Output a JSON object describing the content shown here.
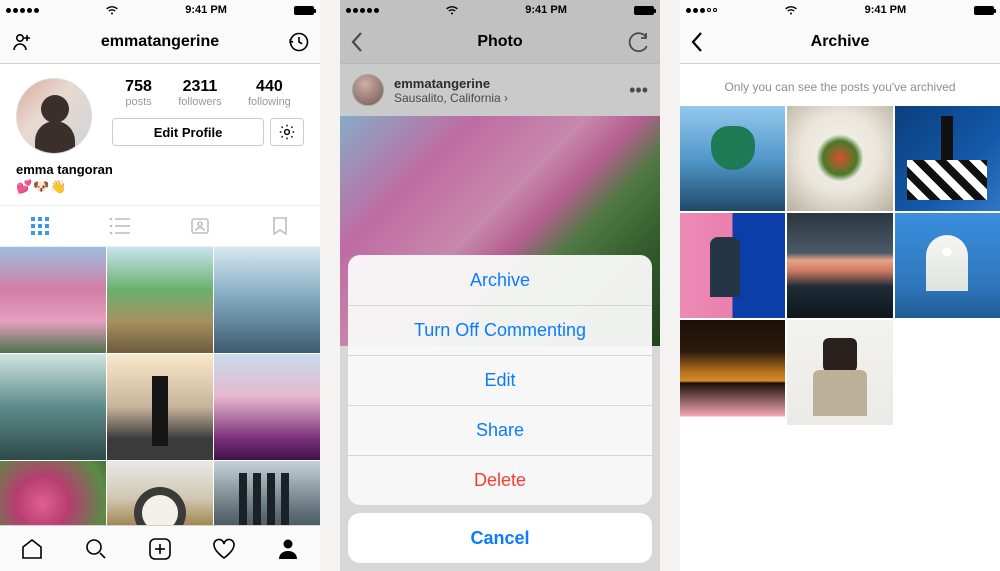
{
  "status": {
    "time": "9:41 PM",
    "signal_dots": 5,
    "wifi_icon": "wifi-icon",
    "battery_full": true
  },
  "screen1": {
    "add_friend_icon": "add-person-icon",
    "title": "emmatangerine",
    "history_icon": "clock-history-icon",
    "stats": {
      "posts": {
        "count": "758",
        "label": "posts"
      },
      "followers": {
        "count": "2311",
        "label": "followers"
      },
      "following": {
        "count": "440",
        "label": "following"
      }
    },
    "edit_profile": "Edit Profile",
    "settings_icon": "gear-icon",
    "display_name": "emma tangoran",
    "bio_emoji": "💕🐶👋",
    "view_tabs": [
      "grid-icon",
      "list-icon",
      "tagged-icon",
      "bookmark-icon"
    ],
    "active_view_tab": 0,
    "thumbs": [
      "t1",
      "t2",
      "t3",
      "t4",
      "t5",
      "t6",
      "t7",
      "t8",
      "t9"
    ],
    "tabbar": [
      "home-icon",
      "search-icon",
      "new-post-icon",
      "activity-icon",
      "profile-icon"
    ],
    "active_tabbar": 4
  },
  "screen2": {
    "back_icon": "chevron-left-icon",
    "title": "Photo",
    "refresh_icon": "refresh-icon",
    "post_user": "emmatangerine",
    "post_location": "Sausalito, California ›",
    "more_icon": "more-icon",
    "sheet": {
      "actions": [
        "Archive",
        "Turn Off Commenting",
        "Edit",
        "Share",
        "Delete"
      ],
      "destructive_index": 4,
      "cancel": "Cancel"
    }
  },
  "screen3": {
    "back_icon": "chevron-left-icon",
    "title": "Archive",
    "note": "Only you can see the posts you've archived",
    "thumbs": [
      "a1",
      "a2",
      "a3",
      "a4",
      "a5",
      "a6",
      "a7",
      "a8"
    ]
  }
}
